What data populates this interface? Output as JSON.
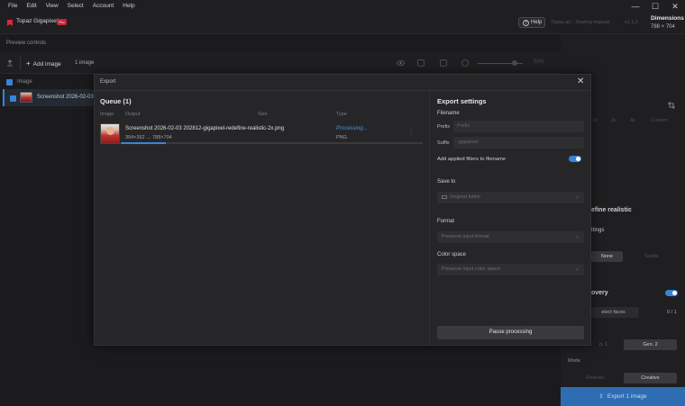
{
  "menu": [
    "File",
    "Edit",
    "View",
    "Select",
    "Account",
    "Help"
  ],
  "window_controls": {
    "minimize": "—",
    "maximize": "☐",
    "close": "✕"
  },
  "app": {
    "name": "Topaz Gigapixel",
    "badge": "Pro"
  },
  "header": {
    "help_label": "Help",
    "faint_1": "Topaz.ai/... floating manual",
    "faint_2": "v1.1.2",
    "dimensions_label": "Dimensions",
    "dimensions_value": "788 × 704"
  },
  "preview_controls_label": "Preview controls",
  "toolbar": {
    "add_image_label": "Add image",
    "image_count": "1 image",
    "zoom_value": "50%"
  },
  "list": {
    "header_label": "Image",
    "row_label": "Screenshot 2026-02-03"
  },
  "right_panel": {
    "tabs": [
      "1x",
      "2x",
      "4x",
      "Custom"
    ],
    "model_title": "efine realistic",
    "settings_label": "ttings",
    "none_btn": "None",
    "subtle_btn": "Subtle",
    "recovery_label": "overy",
    "select_faces_btn": "elect faces",
    "faces_count": "0 / 1",
    "gen1_btn": "n. 1",
    "gen2_btn": "Gen. 2",
    "mode_label": "Mode",
    "realistic_btn": "Realistic",
    "creative_btn": "Creative",
    "export_btn": "Export 1 image"
  },
  "modal": {
    "title": "Export",
    "close": "✕",
    "queue_title": "Queue (1)",
    "columns": [
      "Image",
      "Output",
      "Size",
      "Type"
    ],
    "item": {
      "output_name": "Screenshot 2026-02-03 202812-gigapixel-redefine-realistic-2x.png",
      "dimensions": "394×352 → 788×704",
      "status": "Processing...",
      "type": "PNG",
      "progress": 0.15
    },
    "export_settings": {
      "title": "Export settings",
      "filename_label": "Filename",
      "prefix_label": "Prefix",
      "prefix_placeholder": "Prefix",
      "suffix_label": "Suffix",
      "suffix_value": "-gigapixel",
      "add_filters_label": "Add applied filters to filename",
      "save_to_label": "Save to",
      "save_to_value": "Original folder",
      "format_label": "Format",
      "format_value": "Preserve input format",
      "color_space_label": "Color space",
      "color_space_value": "Preserve input color space",
      "pause_btn": "Pause processing"
    }
  }
}
